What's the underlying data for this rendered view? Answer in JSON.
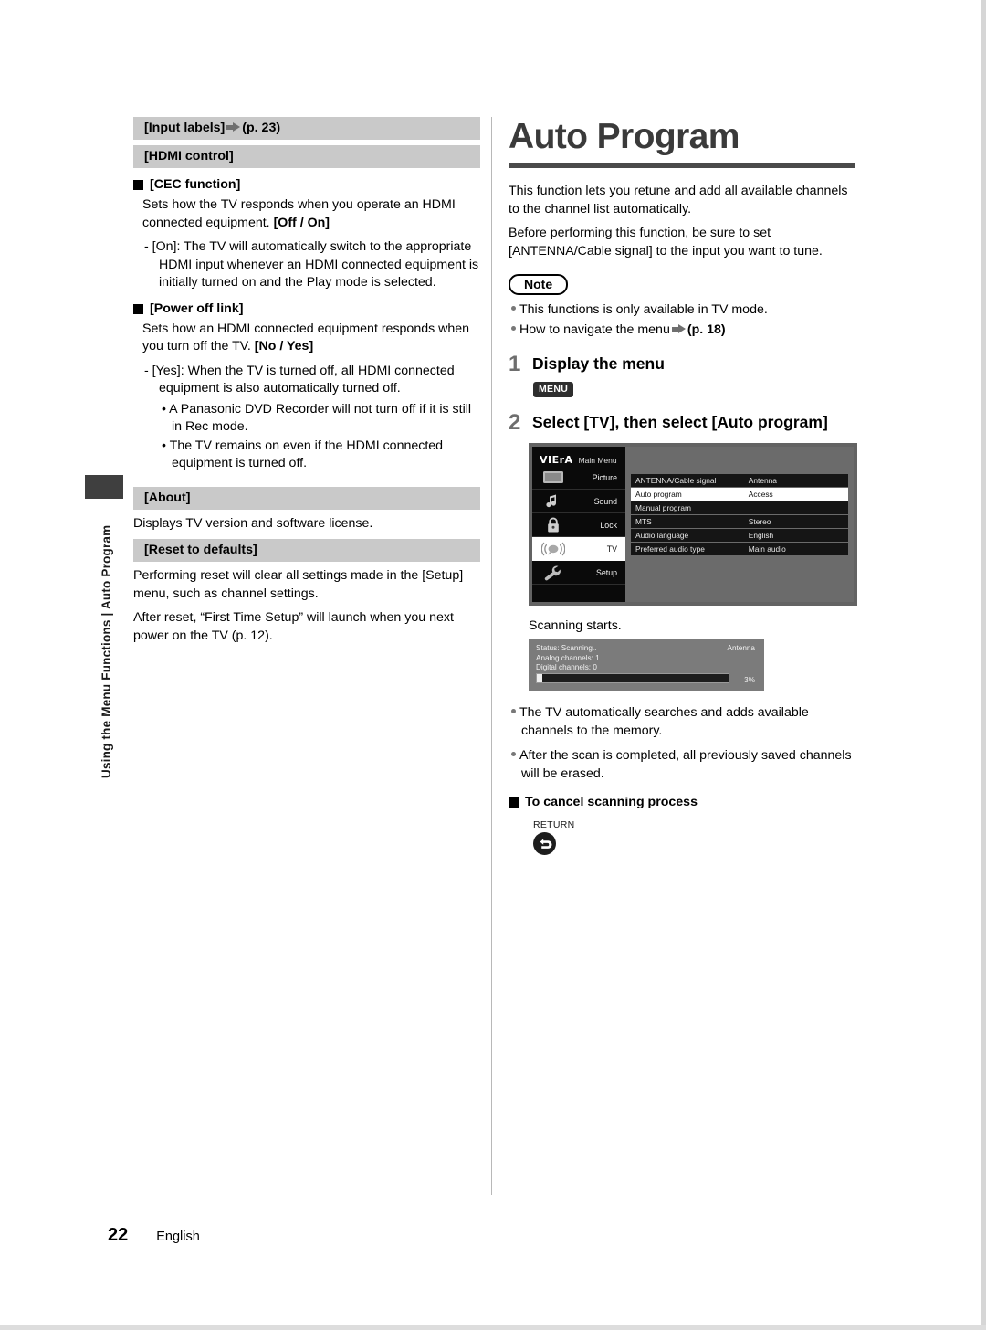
{
  "running_head": "Using the Menu Functions  |  Auto Program",
  "footer": {
    "page_number": "22",
    "language": "English"
  },
  "left_column": {
    "bar_input_labels": "[Input labels]",
    "bar_input_labels_ref": "(p. 23)",
    "bar_hdmi_control": "[HDMI control]",
    "cec_heading": "[CEC function]",
    "cec_body_1": "Sets how the TV responds when you operate an HDMI connected equipment. ",
    "cec_body_1_bold": "[Off / On]",
    "cec_dash_1": "- [On]: The TV will automatically switch to the appropriate HDMI input whenever an HDMI connected equipment is initially turned on and the Play mode is selected.",
    "power_off_heading": "[Power off link]",
    "power_off_body_1": "Sets how an HDMI connected equipment responds when you turn off the TV. ",
    "power_off_body_1_bold": "[No / Yes]",
    "power_off_dash_1": "- [Yes]: When the TV is turned off, all HDMI connected equipment is also automatically turned off.",
    "power_off_dot_1": "• A Panasonic DVD Recorder will not turn off if it is still in Rec mode.",
    "power_off_dot_2": "• The TV remains on even if the HDMI connected equipment is turned off.",
    "bar_about": "[About]",
    "about_body": "Displays TV version and software license.",
    "bar_reset": "[Reset to defaults]",
    "reset_body_1": "Performing reset will clear all settings made in the [Setup] menu, such as channel settings.",
    "reset_body_2": "After reset, “First Time Setup” will launch when you next power on the TV (p. 12)."
  },
  "right_column": {
    "title": "Auto Program",
    "intro_1": "This function lets you retune and add all available channels to the channel list automatically.",
    "intro_2": "Before performing this function, be sure to set [ANTENNA/Cable signal] to the input you want to tune.",
    "note_badge": "Note",
    "note_1": "This functions is only available in TV mode.",
    "note_2_text": "How to navigate the menu",
    "note_2_ref": "(p. 18)",
    "step1_num": "1",
    "step1_text": "Display the menu",
    "step1_key": "MENU",
    "step2_num": "2",
    "step2_text": "Select [TV], then select [Auto program]",
    "scanning_label": "Scanning starts.",
    "bullet_1": "The TV automatically searches and adds available channels to the memory.",
    "bullet_2": "After the scan is completed, all previously saved channels will be erased.",
    "cancel_heading": "To cancel scanning process",
    "return_label": "RETURN"
  },
  "tv_menu_screenshot": {
    "brand": "VIErA",
    "main_menu_label": "Main Menu",
    "side_items": [
      {
        "label": "Picture",
        "icon": "tv-screen-icon",
        "selected": false
      },
      {
        "label": "Sound",
        "icon": "music-note-icon",
        "selected": false
      },
      {
        "label": "Lock",
        "icon": "padlock-icon",
        "selected": false
      },
      {
        "label": "TV",
        "icon": "antenna-broadcast-icon",
        "selected": true
      },
      {
        "label": "Setup",
        "icon": "wrench-icon",
        "selected": false
      }
    ],
    "rows": [
      {
        "name": "ANTENNA/Cable signal",
        "value": "Antenna",
        "highlighted": false
      },
      {
        "name": "Auto program",
        "value": "Access",
        "highlighted": true
      },
      {
        "name": "Manual program",
        "value": "",
        "highlighted": false
      },
      {
        "name": "MTS",
        "value": "Stereo",
        "highlighted": false
      },
      {
        "name": "Audio language",
        "value": "English",
        "highlighted": false
      },
      {
        "name": "Preferred audio type",
        "value": "Main audio",
        "highlighted": false
      }
    ]
  },
  "scan_dialog": {
    "status": "Status: Scanning..",
    "analog": "Analog channels: 1",
    "digital": "Digital channels: 0",
    "source": "Antenna",
    "percent_label": "3%",
    "percent_value": 3
  },
  "colors": {
    "section_bar": "#c9c9c9",
    "title_text": "#3a3a3a",
    "title_rule": "#4a4a4a",
    "step_number": "#6e6e6e",
    "tv_panel_bg": "#6b6b6b",
    "tv_sidebar_bg": "#0a0a0a",
    "scan_box_bg": "#7b7b7b"
  }
}
